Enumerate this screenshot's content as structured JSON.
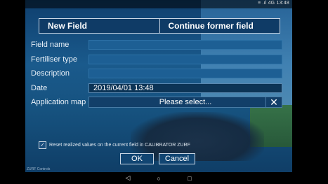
{
  "status_bar": {
    "text": "≡ .ıl 4G 13:48"
  },
  "tabs": {
    "new_field": "New Field",
    "continue_former": "Continue former field"
  },
  "form": {
    "field_name_label": "Field name",
    "field_name_value": "",
    "fertiliser_label": "Fertiliser type",
    "fertiliser_value": "",
    "description_label": "Description",
    "description_value": "",
    "date_label": "Date",
    "date_value": "2019/04/01 13:48",
    "application_map_label": "Application map",
    "application_map_value": "Please select...",
    "clear_symbol": "✕"
  },
  "reset_option": {
    "checked": true,
    "check_mark": "✓",
    "label": "Reset realized values on the current field in CALIBRATOR ZURF"
  },
  "buttons": {
    "ok": "OK",
    "cancel": "Cancel"
  },
  "footer": {
    "text": "ZURF Controls"
  },
  "nav": {
    "back": "◁",
    "home": "○",
    "recents": "□"
  }
}
